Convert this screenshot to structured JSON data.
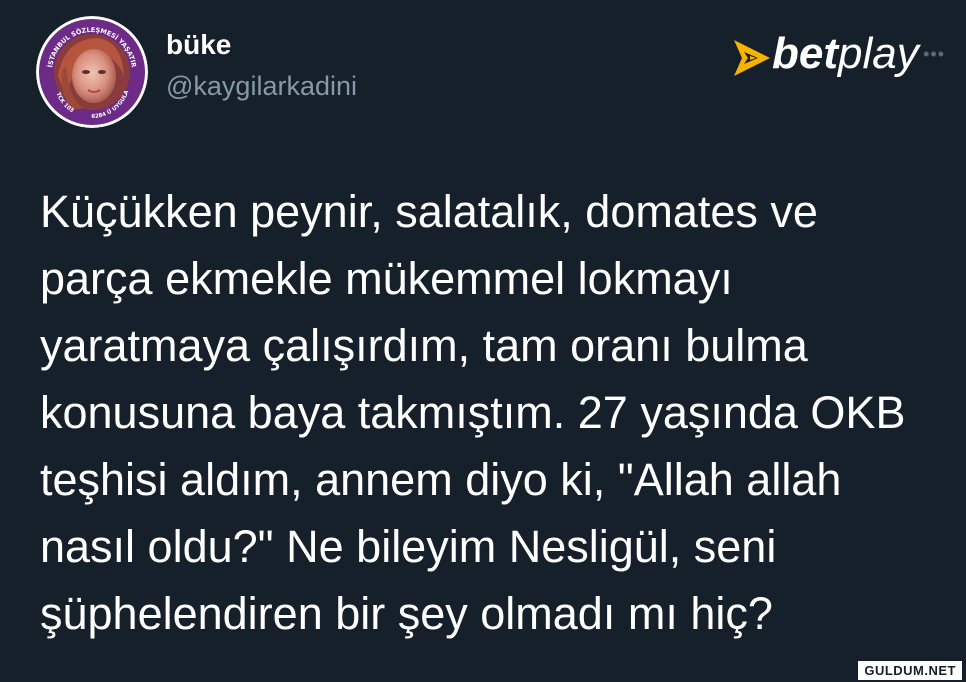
{
  "tweet": {
    "display_name": "büke",
    "handle": "@kaygilarkadini",
    "text_lines": [
      "Küçükken peynir, salatalık, domates ve",
      "parça ekmekle mükemmel lokmayı",
      "yaratmaya çalışırdım, tam oranı bulma",
      "konusuna baya takmıştım. 27 yaşında OKB",
      "teşhisi aldım, annem diyo ki, \"Allah allah",
      "nasıl oldu?\" Ne bileyim Nesligül, seni",
      "şüphelendiren bir şey olmadı mı hiç?"
    ]
  },
  "avatar_badge": {
    "ring_text_top": "İSTANBUL SÖZLEŞMESİ YAŞATIR",
    "ring_text_left": "TCK 103",
    "ring_text_right": "6284 Ü UYGULA",
    "ring_color": "#7b2d8e"
  },
  "brand": {
    "part1": "bet",
    "part2": "play",
    "icon": "rocket-icon",
    "accent_color": "#f5b400"
  },
  "watermark": "GULDUM.NET",
  "colors": {
    "background": "#15202b",
    "secondary_text": "#8899a6"
  }
}
